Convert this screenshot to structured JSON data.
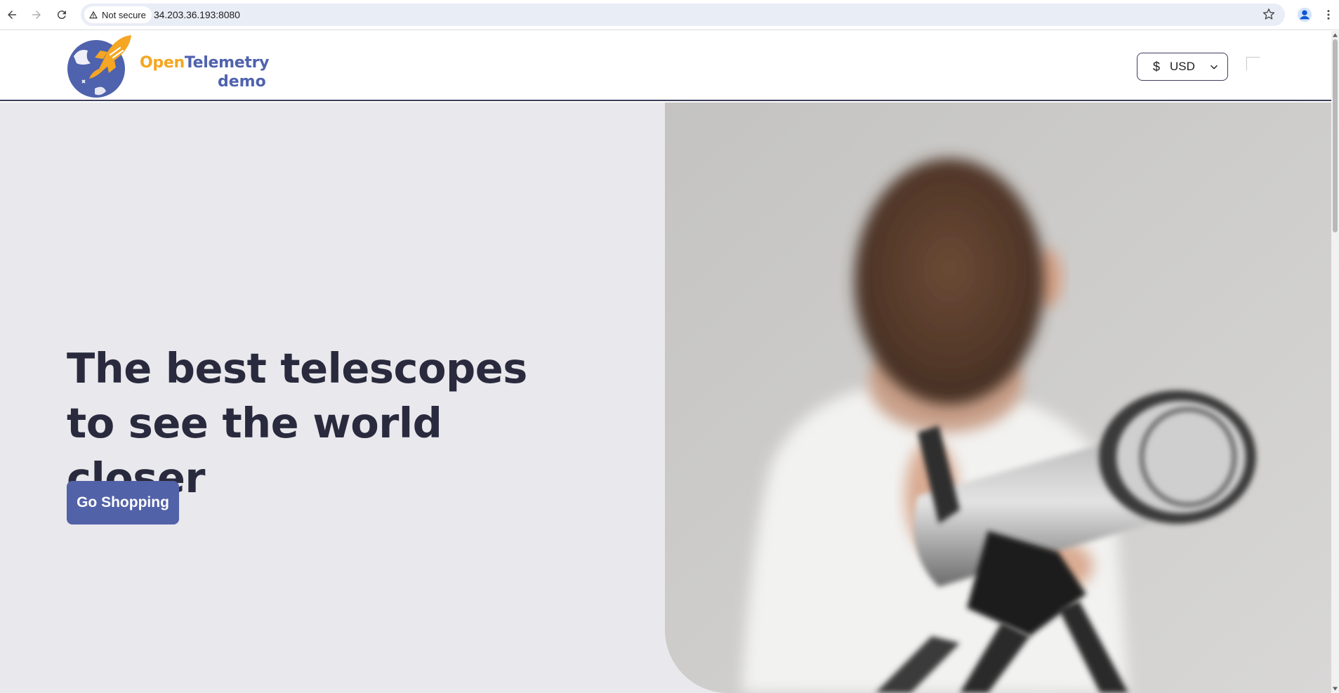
{
  "browser": {
    "security_label": "Not secure",
    "url": "34.203.36.193:8080"
  },
  "header": {
    "logo_open": "Open",
    "logo_telemetry": "Telemetry",
    "logo_demo": "demo",
    "currency_symbol": "$",
    "currency_code": "USD"
  },
  "hero": {
    "title": "The best telescopes to see the world closer",
    "cta_label": "Go Shopping"
  },
  "colors": {
    "brand_orange": "#f5a623",
    "brand_blue": "#4f62ad",
    "button_blue": "#5262a8",
    "hero_bg": "#e9e8ec",
    "title_text": "#292a3d"
  }
}
